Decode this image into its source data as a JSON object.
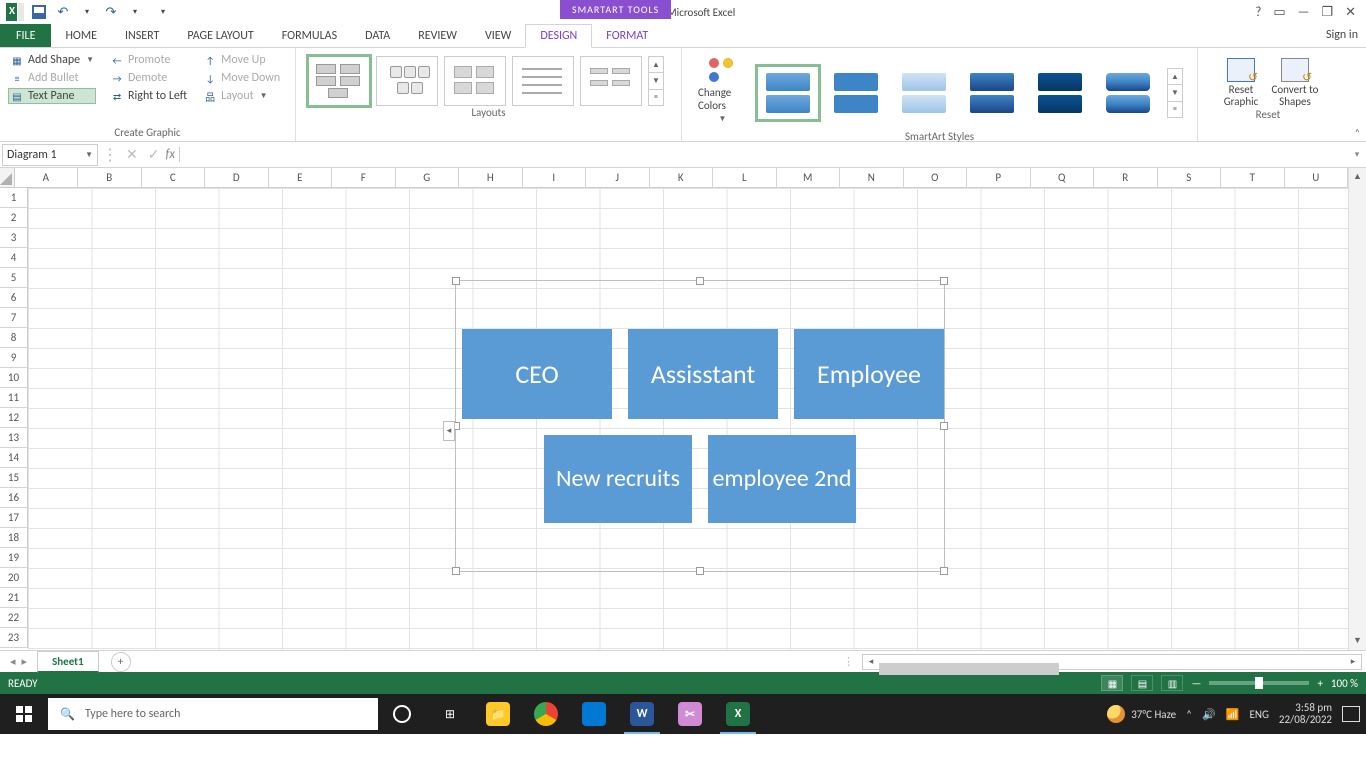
{
  "title": {
    "doc": "Book2 - Microsoft Excel",
    "context_tool": "SMARTART TOOLS"
  },
  "window_controls": {
    "help": "?",
    "ribbonopts": "▭",
    "min": "—",
    "restore": "❐",
    "close": "✕"
  },
  "qat": {
    "undo": "↶",
    "redo": "↷",
    "customize": "▾"
  },
  "tabs": {
    "file": "FILE",
    "home": "HOME",
    "insert": "INSERT",
    "pagelayout": "PAGE LAYOUT",
    "formulas": "FORMULAS",
    "data": "DATA",
    "review": "REVIEW",
    "view": "VIEW",
    "design": "DESIGN",
    "format": "FORMAT",
    "signin": "Sign in"
  },
  "ribbon": {
    "create": {
      "add_shape": "Add Shape",
      "add_bullet": "Add Bullet",
      "text_pane": "Text Pane",
      "promote": "Promote",
      "demote": "Demote",
      "rtl": "Right to Left",
      "move_up": "Move Up",
      "move_down": "Move Down",
      "layout": "Layout",
      "label": "Create Graphic"
    },
    "layouts_label": "Layouts",
    "change_colors": "Change Colors",
    "styles_label": "SmartArt Styles",
    "reset": {
      "reset": "Reset Graphic",
      "convert": "Convert to Shapes",
      "label": "Reset"
    }
  },
  "namebox": "Diagram 1",
  "fx": {
    "cancel": "✕",
    "enter": "✓",
    "fx": "fx"
  },
  "columns": [
    "A",
    "B",
    "C",
    "D",
    "E",
    "F",
    "G",
    "H",
    "I",
    "J",
    "K",
    "L",
    "M",
    "N",
    "O",
    "P",
    "Q",
    "R",
    "S",
    "T",
    "U"
  ],
  "rows": [
    "1",
    "2",
    "3",
    "4",
    "5",
    "6",
    "7",
    "8",
    "9",
    "10",
    "11",
    "12",
    "13",
    "14",
    "15",
    "16",
    "17",
    "18",
    "19",
    "20",
    "21",
    "22",
    "23"
  ],
  "smartart": {
    "r1": [
      "CEO",
      "Assisstant",
      "Employee"
    ],
    "r2": [
      "New recruits",
      "employee 2nd"
    ]
  },
  "textpane_arrow": "◂",
  "sheet_tabs": {
    "sheet1": "Sheet1",
    "add": "+"
  },
  "status": {
    "ready": "READY",
    "zoom": "100 %"
  },
  "taskbar": {
    "search_placeholder": "Type here to search",
    "weather": "37°C  Haze",
    "lang": "ENG",
    "time": "3:58 pm",
    "date": "22/08/2022"
  }
}
